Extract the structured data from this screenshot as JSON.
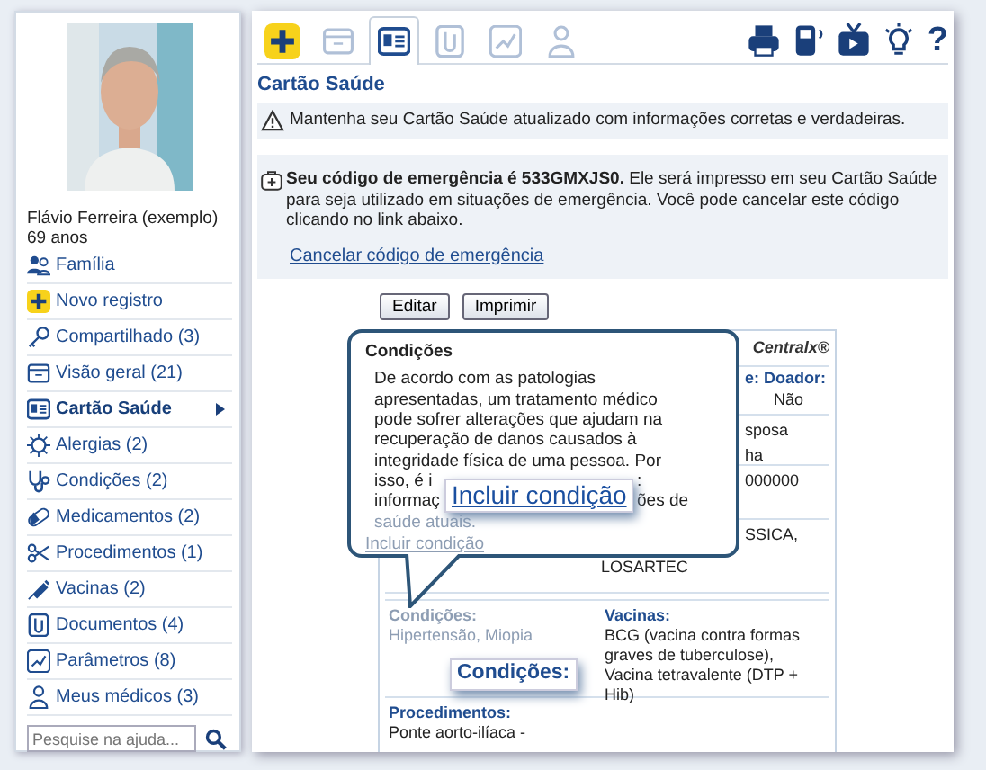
{
  "sidebar": {
    "name": "Flávio Ferreira (exemplo)",
    "age": "69 anos",
    "items": [
      {
        "kind": "family",
        "label": "Família",
        "selected": false
      },
      {
        "kind": "plus",
        "label": "Novo registro",
        "selected": false
      },
      {
        "kind": "key",
        "label": "Compartilhado (3)",
        "selected": false
      },
      {
        "kind": "folder",
        "label": "Visão geral (21)",
        "selected": false
      },
      {
        "kind": "card",
        "label": "Cartão Saúde",
        "selected": true
      },
      {
        "kind": "virus",
        "label": "Alergias (2)",
        "selected": false
      },
      {
        "kind": "stethoscope",
        "label": "Condições (2)",
        "selected": false
      },
      {
        "kind": "pill",
        "label": "Medicamentos (2)",
        "selected": false
      },
      {
        "kind": "scissors",
        "label": "Procedimentos (1)",
        "selected": false
      },
      {
        "kind": "syringe",
        "label": "Vacinas (2)",
        "selected": false
      },
      {
        "kind": "document",
        "label": "Documentos (4)",
        "selected": false
      },
      {
        "kind": "chart",
        "label": "Parâmetros (8)",
        "selected": false
      },
      {
        "kind": "doctor",
        "label": "Meus médicos (3)",
        "selected": false
      }
    ],
    "search": {
      "placeholder": "Pesquise na ajuda..."
    }
  },
  "toolbar": {
    "tabs": [
      {
        "kind": "plus",
        "selected": false,
        "disabled": false
      },
      {
        "kind": "folder",
        "selected": false,
        "disabled": true
      },
      {
        "kind": "card",
        "selected": true,
        "disabled": false
      },
      {
        "kind": "document",
        "selected": false,
        "disabled": true
      },
      {
        "kind": "chart",
        "selected": false,
        "disabled": true
      },
      {
        "kind": "doctor",
        "selected": false,
        "disabled": true
      }
    ],
    "actions": [
      {
        "kind": "printer"
      },
      {
        "kind": "phone"
      },
      {
        "kind": "tv"
      },
      {
        "kind": "bulb"
      },
      {
        "kind": "help",
        "label": "?"
      }
    ]
  },
  "title": "Cartão Saúde",
  "alert": "Mantenha seu Cartão Saúde atualizado com informações corretas e verdadeiras.",
  "emergency": {
    "text": "**Seu código de emergência é 533GMXJS0.** Ele será impresso em seu Cartão Saúde para seja utilizado em situações de emergência. Você pode cancelar este código clicando no link abaixo.",
    "link": "Cancelar código de emergência"
  },
  "buttons": [
    "Editar",
    "Imprimir"
  ],
  "card": {
    "brand": "Centralx®",
    "rows": [
      {
        "texts": [
          "e: Doador:",
          "Não"
        ]
      },
      {
        "texts": [
          "sposa",
          "ha"
        ]
      },
      {
        "texts": [
          "000000"
        ]
      },
      {
        "texts": [
          "SSICA,",
          "LOSARTEC"
        ]
      }
    ],
    "sections": [
      {
        "label": "Condições:",
        "value": "Hipertensão, Miopia",
        "faded": true
      },
      {
        "label": "Vacinas:",
        "value": "BCG (vacina contra formas graves de tuberculose), Vacina tetravalente (DTP + Hib)",
        "faded": false
      }
    ],
    "procedures": {
      "label": "Procedimentos:",
      "value": "Ponte aorto-ilíaca -"
    }
  },
  "tooltip": {
    "title": "Condições",
    "lines": [
      "De acordo com as patologias",
      "apresentadas, um tratamento médico",
      "pode sofrer alterações que ajudam na",
      "recuperação de danos causados à",
      "integridade física de uma pessoa. Por"
    ],
    "split_lines": [
      [
        "isso, é i",
        ":"
      ],
      [
        "informaç",
        "ões de"
      ]
    ],
    "last_line": "saúde atuais.",
    "link": "Incluir condição"
  },
  "magnifiers": [
    {
      "kind": "link",
      "text": "Incluir condição"
    },
    {
      "kind": "label",
      "text": "Condições:"
    }
  ]
}
